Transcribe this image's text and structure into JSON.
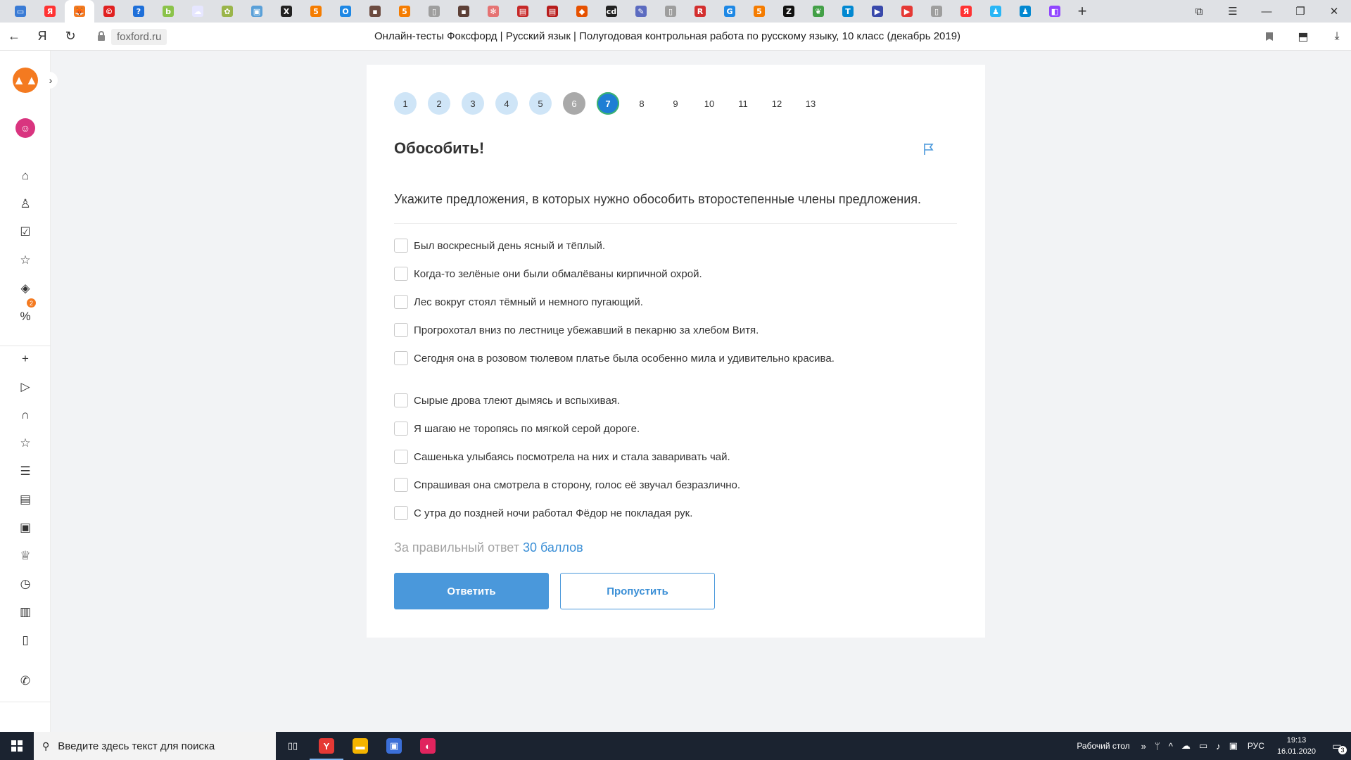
{
  "browser": {
    "tab_favicons": [
      {
        "icon": "window-icon",
        "color": "#3a7bd5",
        "glyph": "▭"
      },
      {
        "icon": "yandex-icon",
        "color": "#ff3333",
        "glyph": "Я"
      },
      {
        "icon": "foxford-icon",
        "color": "#f47a20",
        "glyph": "🦊"
      },
      {
        "icon": "copyright-icon",
        "color": "#e02020",
        "glyph": "©"
      },
      {
        "icon": "question-icon",
        "color": "#1e6fd9",
        "glyph": "?"
      },
      {
        "icon": "b-icon",
        "color": "#8bc34a",
        "glyph": "b"
      },
      {
        "icon": "cloud-icon",
        "color": "#e6e6ff",
        "glyph": "☁"
      },
      {
        "icon": "frog-icon",
        "color": "#9ab54a",
        "glyph": "✿"
      },
      {
        "icon": "picture-icon",
        "color": "#5aa0d8",
        "glyph": "▣"
      },
      {
        "icon": "x-icon",
        "color": "#222222",
        "glyph": "X"
      },
      {
        "icon": "five-icon",
        "color": "#f57c00",
        "glyph": "5"
      },
      {
        "icon": "o-icon",
        "color": "#1e88e5",
        "glyph": "O"
      },
      {
        "icon": "photo-icon",
        "color": "#6d4c41",
        "glyph": "▪"
      },
      {
        "icon": "five-icon",
        "color": "#f57c00",
        "glyph": "5"
      },
      {
        "icon": "document-icon",
        "color": "#9e9e9e",
        "glyph": "▯"
      },
      {
        "icon": "photo-icon",
        "color": "#5d4037",
        "glyph": "▪"
      },
      {
        "icon": "gear-flower-icon",
        "color": "#e57373",
        "glyph": "✻"
      },
      {
        "icon": "book-icon",
        "color": "#c62828",
        "glyph": "▤"
      },
      {
        "icon": "book-icon",
        "color": "#b71c1c",
        "glyph": "▤"
      },
      {
        "icon": "cube-icon",
        "color": "#e65100",
        "glyph": "◆"
      },
      {
        "icon": "cd-icon",
        "color": "#222222",
        "glyph": "cd"
      },
      {
        "icon": "feather-icon",
        "color": "#5c6bc0",
        "glyph": "✎"
      },
      {
        "icon": "document-icon",
        "color": "#9e9e9e",
        "glyph": "▯"
      },
      {
        "icon": "r-icon",
        "color": "#d32f2f",
        "glyph": "R"
      },
      {
        "icon": "g-icon",
        "color": "#1e88e5",
        "glyph": "G"
      },
      {
        "icon": "five-icon",
        "color": "#f57c00",
        "glyph": "5"
      },
      {
        "icon": "z-icon",
        "color": "#111111",
        "glyph": "Z"
      },
      {
        "icon": "leaf-icon",
        "color": "#43a047",
        "glyph": "❦"
      },
      {
        "icon": "t-icon",
        "color": "#0288d1",
        "glyph": "T"
      },
      {
        "icon": "play-icon",
        "color": "#3949ab",
        "glyph": "▶"
      },
      {
        "icon": "youtube-icon",
        "color": "#e53935",
        "glyph": "▶"
      },
      {
        "icon": "document-icon",
        "color": "#9e9e9e",
        "glyph": "▯"
      },
      {
        "icon": "yandex-icon",
        "color": "#ff3333",
        "glyph": "Я"
      },
      {
        "icon": "person-icon",
        "color": "#29b6f6",
        "glyph": "♟"
      },
      {
        "icon": "person-icon",
        "color": "#0288d1",
        "glyph": "♟"
      },
      {
        "icon": "twitch-icon",
        "color": "#9146ff",
        "glyph": "◧"
      }
    ],
    "active_tab_index": 2,
    "new_tab_glyph": "+",
    "window_controls": [
      "⧉",
      "☰",
      "—",
      "❐",
      "✕"
    ],
    "nav": {
      "back": "←",
      "yandex": "Я",
      "reload": "↻"
    },
    "domain": "foxford.ru",
    "page_title": "Онлайн-тесты Фоксфорд | Русский язык | Полугодовая контрольная работа по русскому языку, 10 класс (декабрь 2019)",
    "addr_right": [
      "⬒",
      "⤓"
    ]
  },
  "sidebar": {
    "icons": [
      {
        "name": "home-icon",
        "glyph": "⌂"
      },
      {
        "name": "user-icon",
        "glyph": "♙"
      },
      {
        "name": "checklist-icon",
        "glyph": "☑"
      },
      {
        "name": "star-icon",
        "glyph": "☆"
      },
      {
        "name": "tag-icon",
        "glyph": "◈"
      },
      {
        "name": "percent-icon",
        "glyph": "%"
      },
      {
        "name": "plus-icon",
        "glyph": "+"
      },
      {
        "name": "play-square-icon",
        "glyph": "▷"
      },
      {
        "name": "headphones-icon",
        "glyph": "∩"
      },
      {
        "name": "star-icon",
        "glyph": "☆"
      },
      {
        "name": "list-icon",
        "glyph": "☰"
      },
      {
        "name": "store-icon",
        "glyph": "▤"
      },
      {
        "name": "bus-icon",
        "glyph": "▣"
      },
      {
        "name": "trophy-icon",
        "glyph": "♕"
      },
      {
        "name": "clock-icon",
        "glyph": "◷"
      },
      {
        "name": "briefcase-icon",
        "glyph": "▥"
      },
      {
        "name": "book-icon",
        "glyph": "▯"
      },
      {
        "name": "phone-icon",
        "glyph": "✆"
      }
    ],
    "badge_count": "2"
  },
  "test": {
    "steps": [
      {
        "label": "1",
        "state": "done"
      },
      {
        "label": "2",
        "state": "done"
      },
      {
        "label": "3",
        "state": "done"
      },
      {
        "label": "4",
        "state": "done"
      },
      {
        "label": "5",
        "state": "done"
      },
      {
        "label": "6",
        "state": "skipped"
      },
      {
        "label": "7",
        "state": "current"
      },
      {
        "label": "8",
        "state": "todo"
      },
      {
        "label": "9",
        "state": "todo"
      },
      {
        "label": "10",
        "state": "todo"
      },
      {
        "label": "11",
        "state": "todo"
      },
      {
        "label": "12",
        "state": "todo"
      },
      {
        "label": "13",
        "state": "todo"
      }
    ],
    "question_title": "Обособить!",
    "question_text": "Укажите предложения, в которых нужно обособить второстепенные члены предложения.",
    "options": [
      "Был воскресный день ясный и тёплый.",
      "Когда-то зелёные они были обмалёваны кирпичной охрой.",
      "Лес вокруг стоял тёмный и немного пугающий.",
      "Прогрохотал вниз по лестнице убежавший в пекарню за хлебом Витя.",
      "Сегодня она в розовом тюлевом платье была особенно мила и удивительно красива.",
      "Сырые дрова тлеют дымясь и вспыхивая.",
      "Я шагаю не торопясь по мягкой серой дороге.",
      "Сашенька улыбаясь посмотрела на них и стала заваривать чай.",
      "Спрашивая она смотрела в сторону, голос её звучал безразлично.",
      "С утра до поздней ночи работал Фёдор не покладая рук."
    ],
    "points_prefix": "За правильный ответ",
    "points_value": "30 баллов",
    "answer_button": "Ответить",
    "skip_button": "Пропустить",
    "accent_color": "#4a98db"
  },
  "taskbar": {
    "search_placeholder": "Введите здесь текст для поиска",
    "apps": [
      {
        "name": "task-view-icon",
        "glyph": "▯▯",
        "color": "transparent"
      },
      {
        "name": "yandex-browser-icon",
        "glyph": "Y",
        "color": "#e53935"
      },
      {
        "name": "file-explorer-icon",
        "glyph": "▬",
        "color": "#f4b400"
      },
      {
        "name": "store-icon",
        "glyph": "▣",
        "color": "#3b6fd8"
      },
      {
        "name": "discord-icon",
        "glyph": "◐",
        "color": "#e0245e"
      }
    ],
    "desktop_label": "Рабочий стол",
    "tray_chevron": "»",
    "tray_icons": [
      "ᛘ",
      "^",
      "☁",
      "▭",
      "♪",
      "▣"
    ],
    "language": "РУС",
    "time": "19:13",
    "date": "16.01.2020",
    "notifications_count": "3"
  }
}
